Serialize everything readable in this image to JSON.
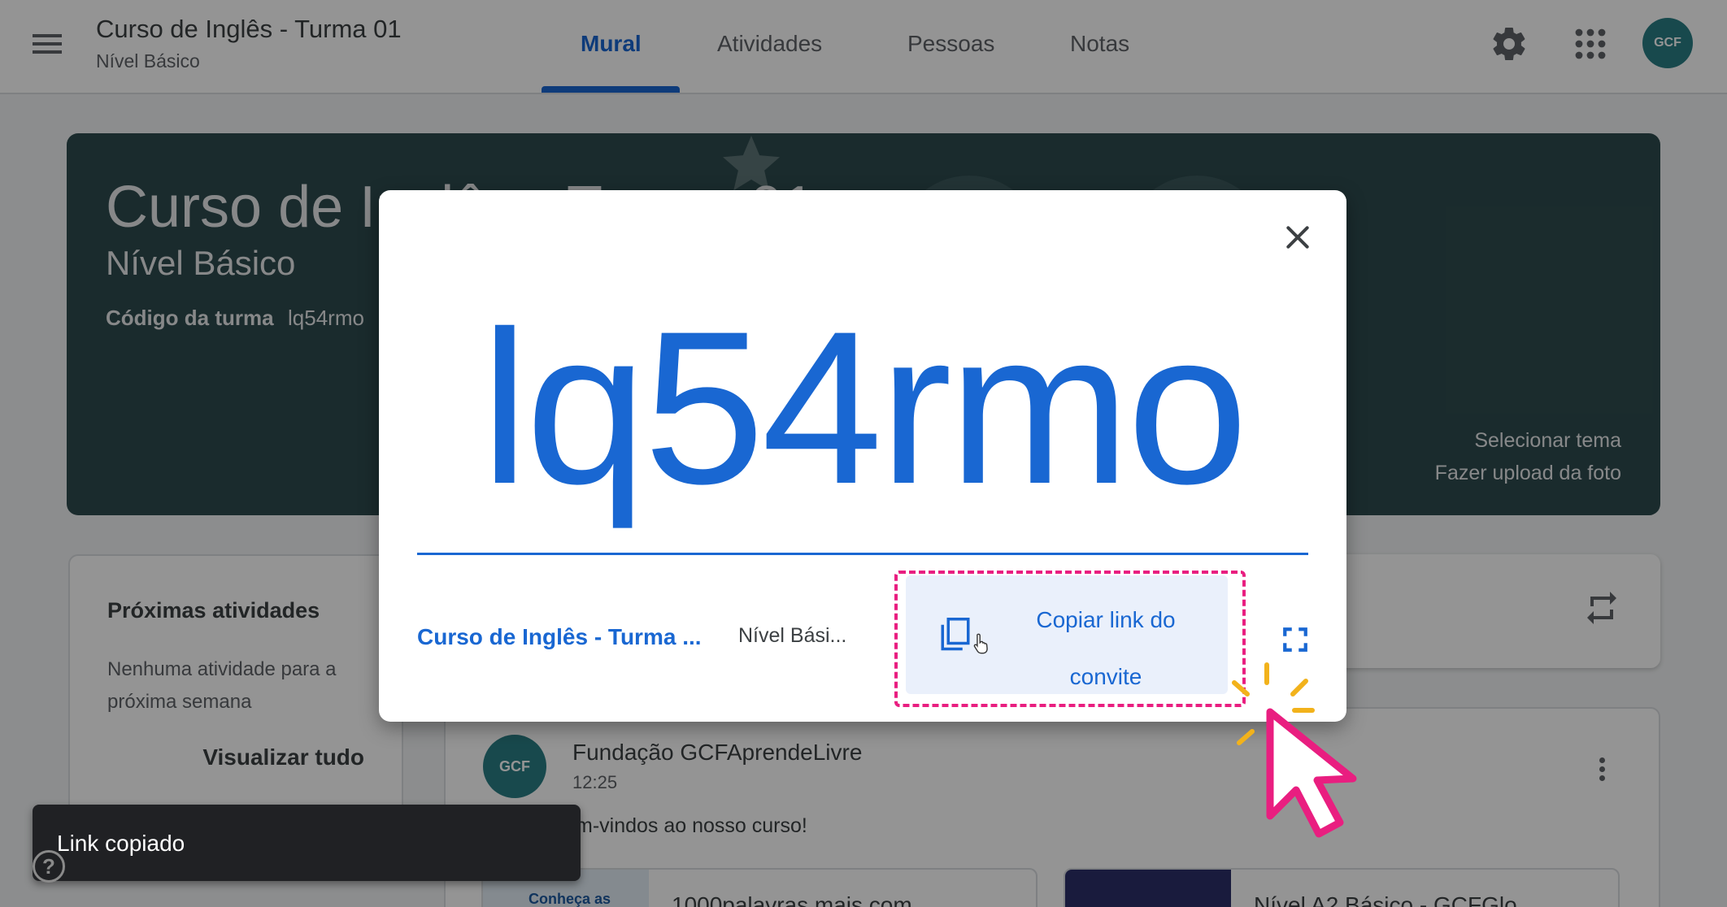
{
  "header": {
    "title": "Curso de Inglês - Turma 01",
    "subtitle": "Nível Básico",
    "tabs": [
      {
        "label": "Mural",
        "active": true
      },
      {
        "label": "Atividades",
        "active": false
      },
      {
        "label": "Pessoas",
        "active": false
      },
      {
        "label": "Notas",
        "active": false
      }
    ],
    "avatar_text": "GCF",
    "icons": [
      "menu-icon",
      "gear-icon",
      "apps-grid-icon"
    ]
  },
  "banner": {
    "title": "Curso de Inglês - Turma 01",
    "subtitle": "Nível Básico",
    "code_label": "Código da turma",
    "code_value": "lq54rmo",
    "select_theme": "Selecionar tema",
    "upload_photo": "Fazer upload da foto",
    "color": "#2e4b4e"
  },
  "upcoming": {
    "title": "Próximas atividades",
    "empty_text": "Nenhuma atividade para a próxima semana",
    "view_all": "Visualizar tudo"
  },
  "post": {
    "avatar_text": "GCF",
    "author": "Fundação GCFAprendeLivre",
    "time": "12:25",
    "text": "m-vindos ao nosso curso!",
    "attachments": [
      {
        "thumb_text": "Conheça as",
        "title": "1000palavras mais com"
      },
      {
        "thumb_text": "",
        "title": "Nível A2 Básico - GCFGlo"
      }
    ]
  },
  "dialog": {
    "code": "lq54rmo",
    "class_name": "Curso de Inglês - Turma ...",
    "level": "Nível Bási...",
    "copy_label": "Copiar link do convite",
    "accent_color": "#1967d2",
    "highlight_color": "#e91e80"
  },
  "snackbar": {
    "text": "Link copiado"
  }
}
